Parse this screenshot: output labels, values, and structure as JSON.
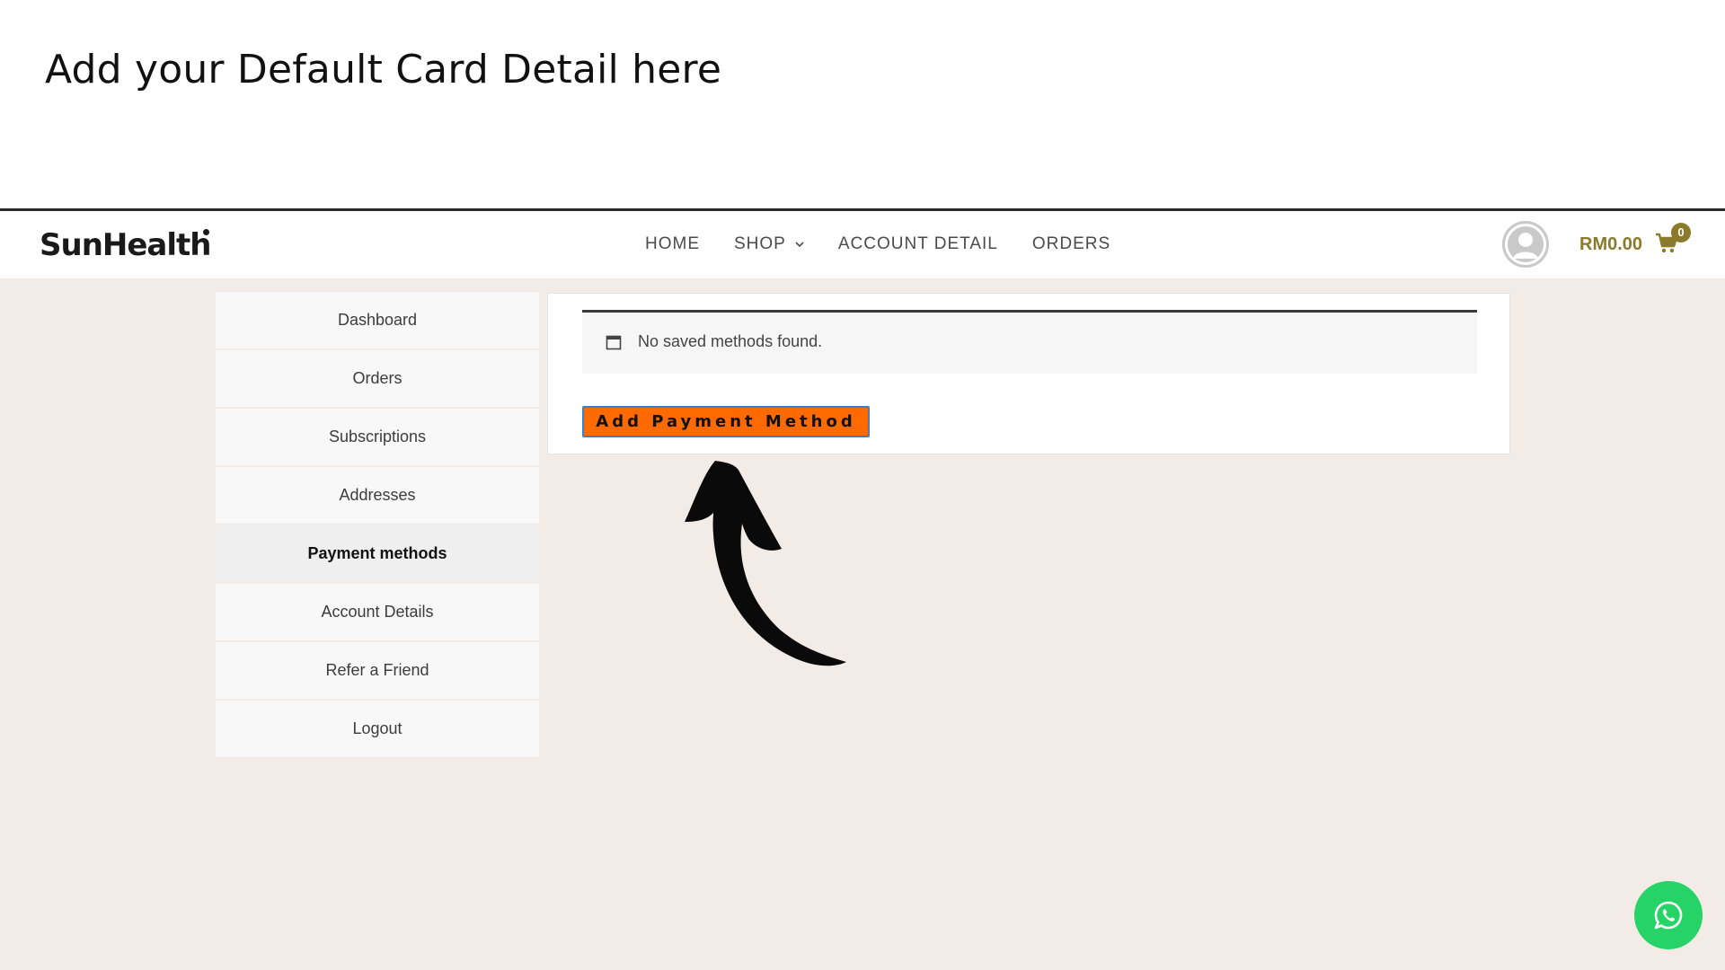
{
  "instruction": {
    "title": "Add your Default Card Detail here"
  },
  "header": {
    "logo": "SunHealth",
    "nav": [
      {
        "label": "HOME"
      },
      {
        "label": "SHOP"
      },
      {
        "label": "ACCOUNT DETAIL"
      },
      {
        "label": "ORDERS"
      }
    ],
    "cart_total": "RM0.00",
    "cart_count": "0"
  },
  "account_nav": {
    "items": [
      {
        "label": "Dashboard"
      },
      {
        "label": "Orders"
      },
      {
        "label": "Subscriptions"
      },
      {
        "label": "Addresses"
      },
      {
        "label": "Payment methods"
      },
      {
        "label": "Account Details"
      },
      {
        "label": "Refer a Friend"
      },
      {
        "label": "Logout"
      }
    ],
    "active": "Payment methods"
  },
  "payment_methods": {
    "notice": "No saved methods found.",
    "add_button": "Add Payment Method"
  },
  "icons": {
    "notice": "calendar-icon",
    "cart": "cart-icon",
    "chat": "whatsapp-icon",
    "annotation": "curved-arrow-icon"
  },
  "colors": {
    "accent_button": "#ff6a00",
    "page_background": "#f3ece6",
    "cart_accent": "#8a7a2a",
    "whatsapp": "#25d366"
  }
}
